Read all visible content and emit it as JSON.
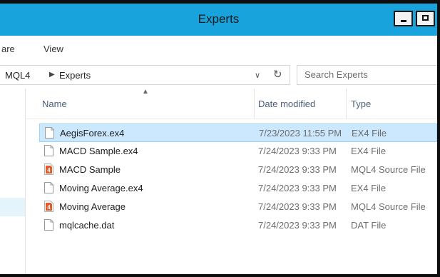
{
  "window": {
    "title": "Experts"
  },
  "ribbon": {
    "tabs": [
      {
        "label": "are"
      },
      {
        "label": "View"
      }
    ]
  },
  "address": {
    "crumbs": [
      "MQL4",
      "Experts"
    ]
  },
  "search": {
    "placeholder": "Search Experts"
  },
  "columns": {
    "name": "Name",
    "date": "Date modified",
    "type": "Type"
  },
  "files": [
    {
      "name": "AegisForex.ex4",
      "date": "7/23/2023 11:55 PM",
      "type": "EX4 File",
      "icon": "file-icon",
      "selected": true
    },
    {
      "name": "MACD Sample.ex4",
      "date": "7/24/2023 9:33 PM",
      "type": "EX4 File",
      "icon": "file-icon"
    },
    {
      "name": "MACD Sample",
      "date": "7/24/2023 9:33 PM",
      "type": "MQL4 Source File",
      "icon": "mql4-file-icon"
    },
    {
      "name": "Moving Average.ex4",
      "date": "7/24/2023 9:33 PM",
      "type": "EX4 File",
      "icon": "file-icon"
    },
    {
      "name": "Moving Average",
      "date": "7/24/2023 9:33 PM",
      "type": "MQL4 Source File",
      "icon": "mql4-file-icon"
    },
    {
      "name": "mqlcache.dat",
      "date": "7/24/2023 9:33 PM",
      "type": "DAT File",
      "icon": "file-icon"
    }
  ],
  "colors": {
    "titlebar": "#19a3dc",
    "selection": "#cce8ff",
    "selection_border": "#99d1ff",
    "mql4_icon": "#e25c2b"
  }
}
